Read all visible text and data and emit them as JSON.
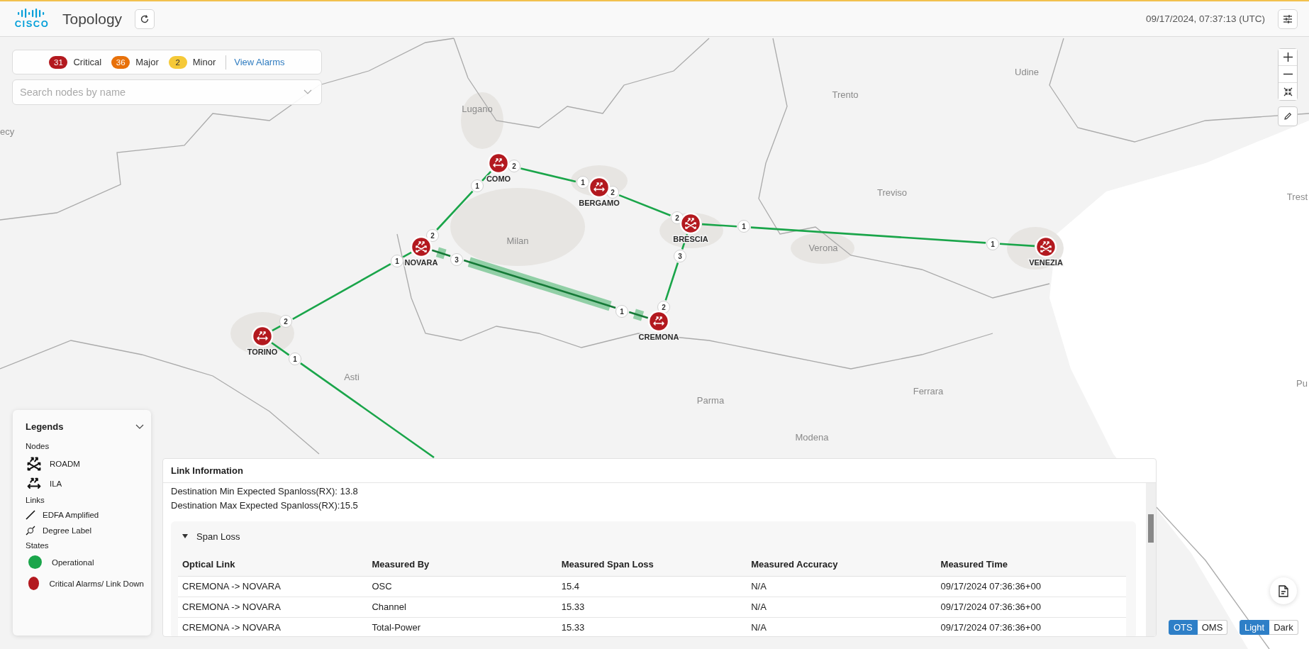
{
  "header": {
    "logo_text": "CISCO",
    "title": "Topology",
    "timestamp": "09/17/2024, 07:37:13 (UTC)"
  },
  "alarms": [
    {
      "count": "31",
      "label": "Critical",
      "color": "#b3191f"
    },
    {
      "count": "36",
      "label": "Major",
      "color": "#e8710a"
    },
    {
      "count": "2",
      "label": "Minor",
      "color": "#f5c938"
    }
  ],
  "view_alarms": "View Alarms",
  "search": {
    "placeholder": "Search nodes by name"
  },
  "map": {
    "places": [
      "ecy",
      "Lugano",
      "Trento",
      "Udine",
      "Treviso",
      "Trest",
      "Milan",
      "Verona",
      "Asti",
      "Parma",
      "Ferrara",
      "Modena",
      "Pu"
    ],
    "nodes": [
      {
        "name": "COMO",
        "kind": "ila"
      },
      {
        "name": "BERGAMO",
        "kind": "ila"
      },
      {
        "name": "BRESCIA",
        "kind": "roadm"
      },
      {
        "name": "VENEZIA",
        "kind": "roadm"
      },
      {
        "name": "NOVARA",
        "kind": "roadm"
      },
      {
        "name": "CREMONA",
        "kind": "ila"
      },
      {
        "name": "TORINO",
        "kind": "ila"
      }
    ],
    "links": [
      {
        "degrees": [
          "1",
          "2"
        ],
        "selected": false
      },
      {
        "degrees": [
          "2",
          "1"
        ],
        "selected": false
      },
      {
        "degrees": [
          "2",
          "2"
        ],
        "selected": false
      },
      {
        "degrees": [
          "3",
          "2"
        ],
        "selected": false
      },
      {
        "degrees": [
          "1",
          "1"
        ],
        "selected": false
      },
      {
        "degrees": [
          "1",
          "2"
        ],
        "selected": false
      },
      {
        "degrees": [
          "3",
          "1"
        ],
        "selected": true
      },
      {
        "degrees": [
          "1"
        ],
        "selected": false
      }
    ]
  },
  "legend": {
    "title": "Legends",
    "sections": [
      {
        "title": "Nodes",
        "items": [
          {
            "label": "ROADM",
            "kind": "roadm"
          },
          {
            "label": "ILA",
            "kind": "ila"
          }
        ]
      },
      {
        "title": "Links",
        "items": [
          {
            "label": "EDFA Amplified",
            "kind": "link"
          },
          {
            "label": "Degree Label",
            "kind": "degree"
          }
        ]
      },
      {
        "title": "States",
        "items": [
          {
            "label": "Operational",
            "kind": "state",
            "color": "#1aa54a"
          },
          {
            "label": "Critical Alarms/ Link Down",
            "kind": "state",
            "color": "#b3191f"
          }
        ]
      }
    ]
  },
  "link_info": {
    "title": "Link Information",
    "lines": [
      "Destination Min Expected Spanloss(RX): 13.8",
      "Destination Max Expected Spanloss(RX):15.5"
    ],
    "section": {
      "title": "Span Loss",
      "expanded": true,
      "columns": [
        "Optical Link",
        "Measured By",
        "Measured Span Loss",
        "Measured Accuracy",
        "Measured Time"
      ],
      "rows": [
        [
          "CREMONA -> NOVARA",
          "OSC",
          "15.4",
          "N/A",
          "09/17/2024 07:36:36+00"
        ],
        [
          "CREMONA -> NOVARA",
          "Channel",
          "15.33",
          "N/A",
          "09/17/2024 07:36:36+00"
        ],
        [
          "CREMONA -> NOVARA",
          "Total-Power",
          "15.33",
          "N/A",
          "09/17/2024 07:36:36+00"
        ]
      ]
    }
  },
  "toggles": [
    {
      "options": [
        {
          "label": "OTS",
          "selected": true
        },
        {
          "label": "OMS",
          "selected": false
        }
      ]
    },
    {
      "options": [
        {
          "label": "Light",
          "selected": true
        },
        {
          "label": "Dark",
          "selected": false
        }
      ]
    }
  ]
}
